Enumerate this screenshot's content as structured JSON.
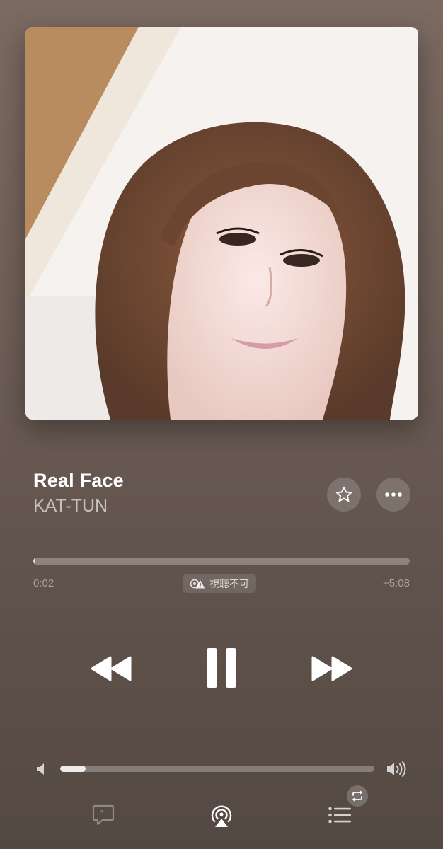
{
  "now_playing": {
    "title": "Real Face",
    "artist": "KAT-TUN",
    "elapsed": "0:02",
    "remaining": "−5:08",
    "progress": 0.006,
    "preview_label": "視聴不可"
  },
  "volume": {
    "level": 0.08
  },
  "icons": {
    "favorite": "star-icon",
    "more": "ellipsis-icon",
    "rewind": "rewind-icon",
    "pause": "pause-icon",
    "forward": "fast-forward-icon",
    "volume_low": "speaker-low-icon",
    "volume_high": "speaker-high-icon",
    "lyrics": "lyrics-bubble-icon",
    "airplay": "airplay-icon",
    "queue": "queue-list-icon",
    "repeat": "repeat-icon"
  },
  "colors": {
    "background_top": "#7b6a62",
    "background_bottom": "#544942"
  }
}
